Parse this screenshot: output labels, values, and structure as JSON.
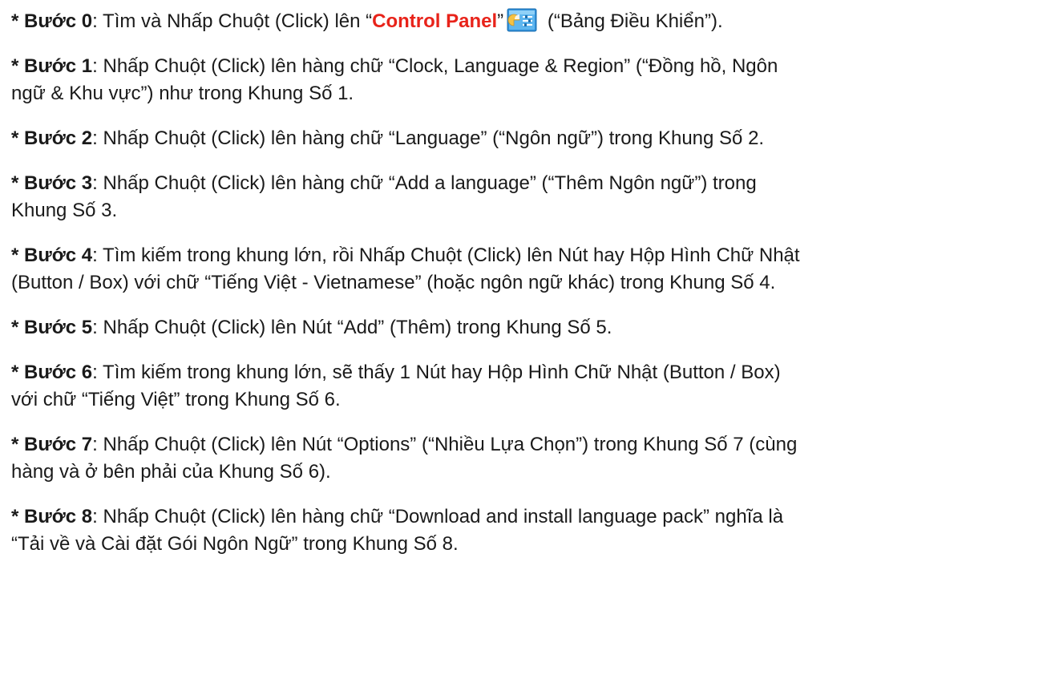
{
  "steps": [
    {
      "prefix": "* ",
      "label": "Bước 0",
      "lines": [
        {
          "before": ": Tìm và Nhấp Chuột (Click) lên “",
          "highlight": "Control Panel",
          "after_highlight": "”",
          "icon": "control-panel-icon",
          "after_icon": " (“Bảng Điều Khiển”)."
        }
      ]
    },
    {
      "prefix": "* ",
      "label": "Bước 1",
      "lines": [
        ": Nhấp Chuột (Click) lên hàng chữ “Clock, Language & Region” (“Đồng hồ, Ngôn",
        "ngữ & Khu vực”) như trong Khung Số 1."
      ]
    },
    {
      "prefix": "* ",
      "label": "Bước 2",
      "lines": [
        ": Nhấp Chuột (Click) lên hàng chữ “Language” (“Ngôn ngữ”) trong Khung Số 2."
      ]
    },
    {
      "prefix": "* ",
      "label": "Bước 3",
      "lines": [
        ": Nhấp Chuột (Click) lên hàng chữ “Add a language” (“Thêm Ngôn ngữ”) trong",
        "Khung Số 3."
      ]
    },
    {
      "prefix": "* ",
      "label": "Bước 4",
      "lines": [
        ": Tìm kiếm trong khung lớn, rồi Nhấp Chuột (Click) lên Nút hay Hộp Hình Chữ Nhật",
        "(Button / Box) với chữ “Tiếng Việt - Vietnamese” (hoặc ngôn ngữ khác) trong Khung Số 4."
      ]
    },
    {
      "prefix": "* ",
      "label": "Bước 5",
      "lines": [
        ": Nhấp Chuột (Click) lên Nút “Add” (Thêm) trong Khung Số 5."
      ]
    },
    {
      "prefix": "* ",
      "label": "Bước 6",
      "lines": [
        ": Tìm kiếm trong khung lớn, sẽ thấy 1 Nút hay Hộp Hình Chữ Nhật (Button / Box)",
        "với chữ “Tiếng Việt” trong Khung Số 6."
      ]
    },
    {
      "prefix": "* ",
      "label": "Bước 7",
      "lines": [
        ": Nhấp Chuột (Click) lên Nút “Options” (“Nhiều Lựa Chọn”) trong Khung Số 7 (cùng",
        "hàng và ở bên phải của Khung Số 6)."
      ]
    },
    {
      "prefix": "* ",
      "label": "Bước 8",
      "lines": [
        ": Nhấp Chuột (Click) lên hàng chữ “Download and install language pack” nghĩa là",
        "“Tải về và Cài đặt Gói Ngôn Ngữ” trong Khung Số 8."
      ]
    }
  ],
  "colors": {
    "text": "#1a1a1a",
    "highlight": "#e8231a",
    "icon_blue": "#3aa0e0",
    "icon_yellow": "#f5c242"
  }
}
